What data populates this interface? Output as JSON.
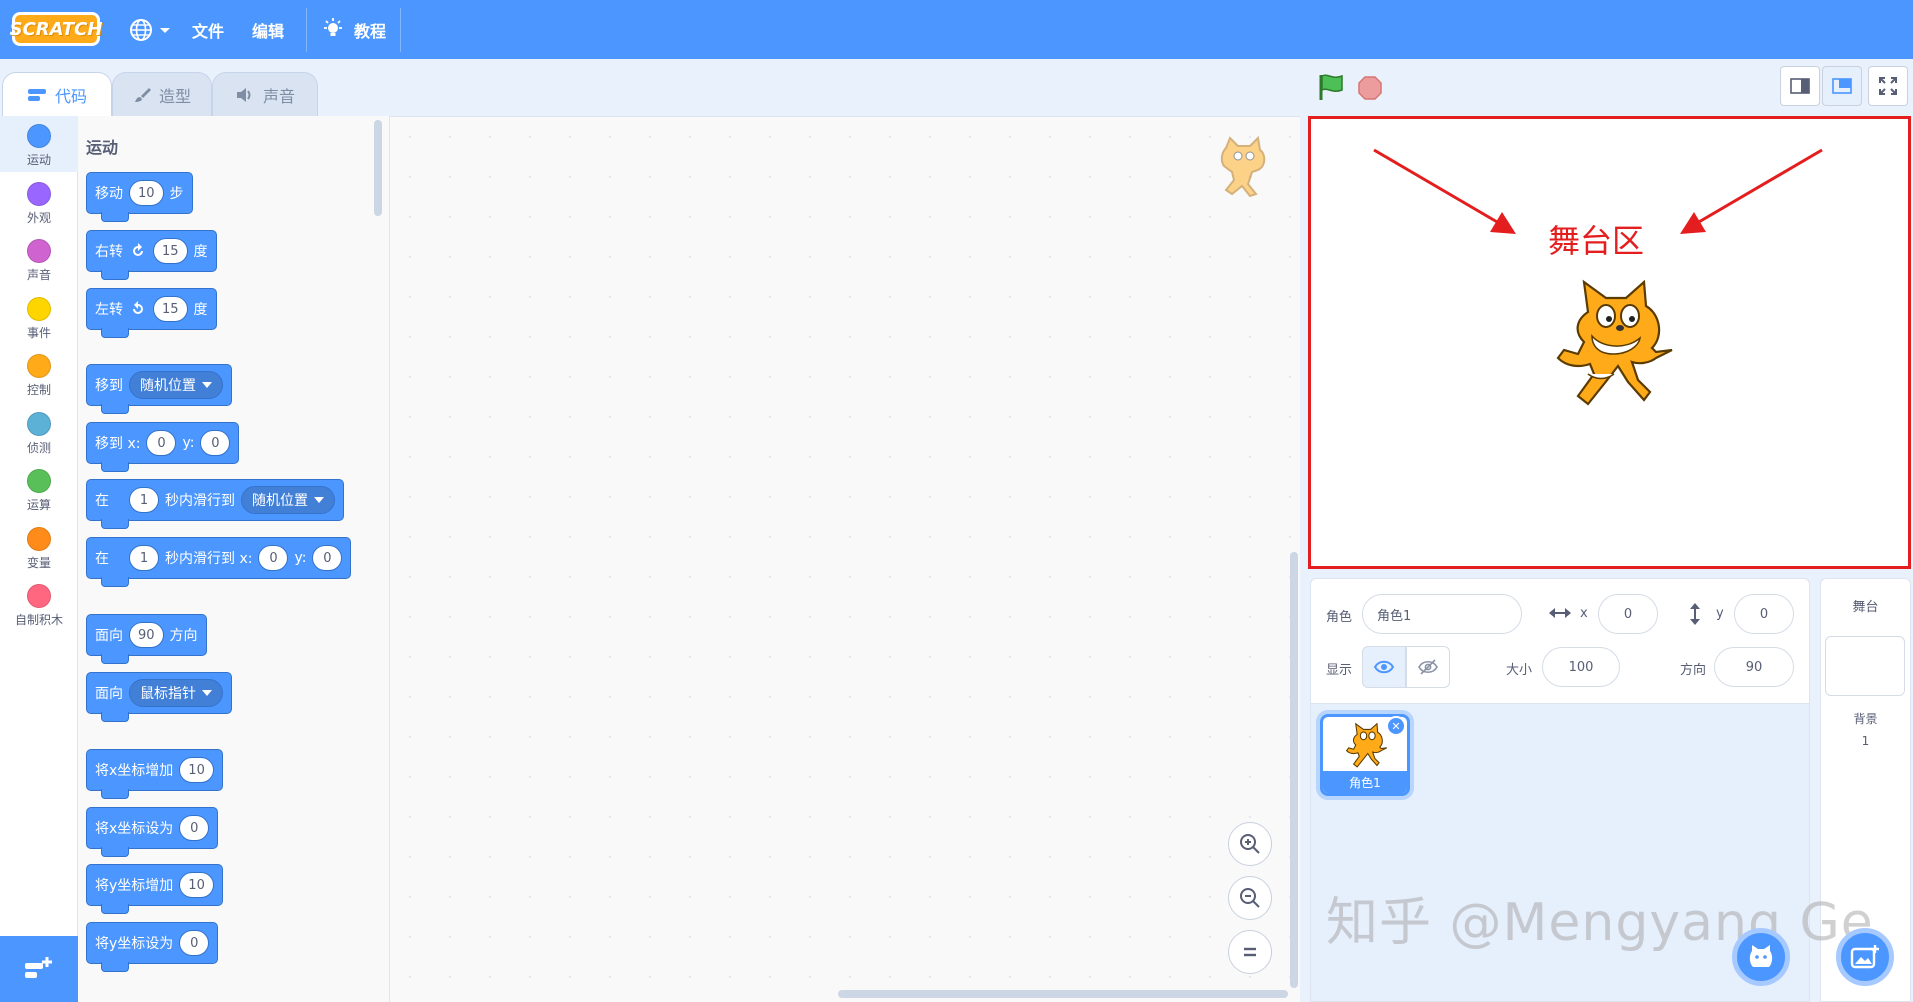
{
  "menubar": {
    "logo": "SCRATCH",
    "file": "文件",
    "edit": "编辑",
    "tutorials": "教程"
  },
  "tabs": [
    {
      "label": "代码",
      "active": true
    },
    {
      "label": "造型",
      "active": false
    },
    {
      "label": "声音",
      "active": false
    }
  ],
  "categories": [
    {
      "label": "运动",
      "color": "#4c97ff"
    },
    {
      "label": "外观",
      "color": "#9966ff"
    },
    {
      "label": "声音",
      "color": "#cf63cf"
    },
    {
      "label": "事件",
      "color": "#ffd500"
    },
    {
      "label": "控制",
      "color": "#ffab19"
    },
    {
      "label": "侦测",
      "color": "#5cb1d6"
    },
    {
      "label": "运算",
      "color": "#59c059"
    },
    {
      "label": "变量",
      "color": "#ff8c1a"
    },
    {
      "label": "自制积木",
      "color": "#ff6680"
    }
  ],
  "palette": {
    "section": "运动",
    "blocks": {
      "move": {
        "pre": "移动",
        "val": "10",
        "post": "步"
      },
      "turn_right": {
        "pre": "右转",
        "val": "15",
        "post": "度"
      },
      "turn_left": {
        "pre": "左转",
        "val": "15",
        "post": "度"
      },
      "goto": {
        "pre": "移到",
        "drop": "随机位置"
      },
      "goto_xy": {
        "pre": "移到 x:",
        "x": "0",
        "ylabel": "y:",
        "y": "0"
      },
      "glide": {
        "pre": "在",
        "val": "1",
        "mid": "秒内滑行到",
        "drop": "随机位置"
      },
      "glide_xy": {
        "pre": "在",
        "val": "1",
        "mid": "秒内滑行到 x:",
        "x": "0",
        "ylabel": "y:",
        "y": "0"
      },
      "point_dir": {
        "pre": "面向",
        "val": "90",
        "post": "方向"
      },
      "point_towards": {
        "pre": "面向",
        "drop": "鼠标指针"
      },
      "change_x": {
        "pre": "将x坐标增加",
        "val": "10"
      },
      "set_x": {
        "pre": "将x坐标设为",
        "val": "0"
      },
      "change_y": {
        "pre": "将y坐标增加",
        "val": "10"
      },
      "set_y": {
        "pre": "将y坐标设为",
        "val": "0"
      }
    }
  },
  "stage": {
    "annotation": "舞台区",
    "annotation_color": "#e41e1e"
  },
  "sprite_info": {
    "sprite_label": "角色",
    "sprite_name": "角色1",
    "x_label": "x",
    "x": "0",
    "y_label": "y",
    "y": "0",
    "show_label": "显示",
    "size_label": "大小",
    "size": "100",
    "direction_label": "方向",
    "direction": "90"
  },
  "sprites": [
    {
      "name": "角色1"
    }
  ],
  "stage_pane": {
    "title": "舞台",
    "backdrop_label": "背景",
    "backdrop_count": "1"
  },
  "watermark": "知乎 @Mengyang Ge",
  "accent": "#4c97ff"
}
